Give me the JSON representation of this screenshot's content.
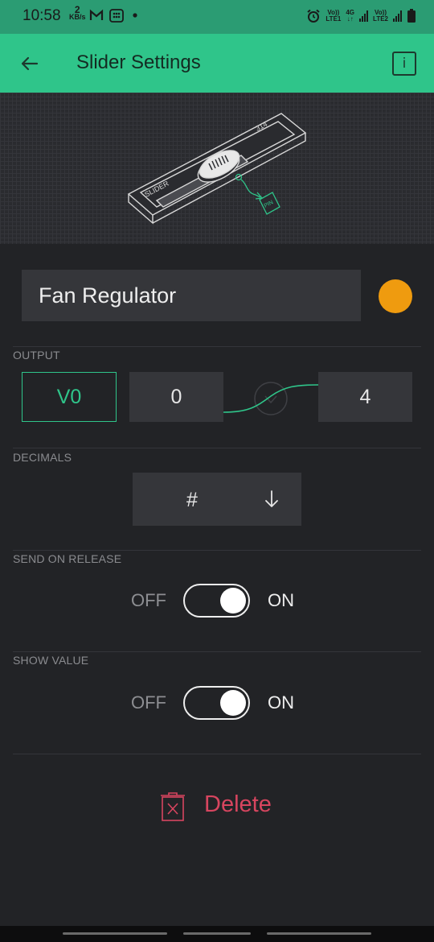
{
  "status_bar": {
    "time": "10:58",
    "speed_value": "2",
    "speed_unit": "KB/s",
    "sim1_label_top": "Vo))",
    "sim1_label_bottom": "LTE1",
    "net_type": "4G",
    "sim2_label_top": "Vo))",
    "sim2_label_bottom": "LTE2",
    "icons": [
      "gmail-icon",
      "grid-app-icon",
      "dot-icon",
      "alarm-icon",
      "signal-icon",
      "battery-icon"
    ]
  },
  "toolbar": {
    "title": "Slider Settings",
    "info_label": "i",
    "background": "#2fc58a"
  },
  "hero": {
    "slider_label": "SLIDER",
    "slider_value": "314",
    "pin_label": "PIN"
  },
  "widget": {
    "name": "Fan Regulator",
    "color": "#ef9b0f"
  },
  "output": {
    "section_label": "OUTPUT",
    "pin": "V0",
    "min": "0",
    "max": "4"
  },
  "decimals": {
    "section_label": "DECIMALS",
    "value": "#",
    "arrow": "↓"
  },
  "send_on_release": {
    "section_label": "SEND ON RELEASE",
    "off_label": "OFF",
    "on_label": "ON",
    "state": "on"
  },
  "show_value": {
    "section_label": "SHOW VALUE",
    "off_label": "OFF",
    "on_label": "ON",
    "state": "on"
  },
  "delete": {
    "label": "Delete",
    "color": "#d7455f"
  }
}
